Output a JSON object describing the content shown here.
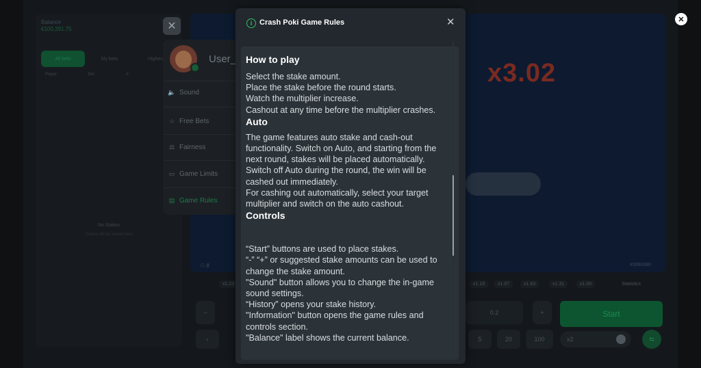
{
  "background": {
    "balance_label": "Balance",
    "balance_value": "€100,391.75",
    "tabs": [
      "All bets",
      "My bets",
      "Highest"
    ],
    "columns": [
      "Player",
      "Bet",
      "X"
    ],
    "no_stakes": "No Stakes",
    "no_stakes_sub": "Stakes will be shown here",
    "multiplier": "x3.02",
    "players_count": "8",
    "round_id": "#3990380",
    "history": [
      "x1.23",
      "x1.18",
      "x1.07",
      "x1.63",
      "x1.31",
      "x1.00"
    ],
    "statistics": "Statistics",
    "stake_value": "0.2",
    "minus": "−",
    "plus": "+",
    "start_label": "Start",
    "quick_amounts": [
      "5",
      "20",
      "100"
    ],
    "auto_value": "x2"
  },
  "menu": {
    "username": "User_",
    "items": [
      {
        "label": "Sound",
        "icon": "speaker-icon"
      },
      {
        "label": "Free Bets",
        "icon": "star-icon"
      },
      {
        "label": "Fairness",
        "icon": "scale-icon"
      },
      {
        "label": "Game Limits",
        "icon": "limits-icon"
      },
      {
        "label": "Game Rules",
        "icon": "rules-icon"
      }
    ],
    "active_item": "Game Rules"
  },
  "modal": {
    "title": "Crash Poki Game Rules",
    "sections": [
      {
        "heading": "How to play",
        "lines": [
          "Select the stake amount.",
          "Place the stake before the round starts.",
          "Watch the multiplier increase.",
          "Cashout at any time before the multiplier crashes."
        ]
      },
      {
        "heading": "Auto",
        "lines": [
          "The game features auto stake and cash-out functionality. Switch on Auto, and starting from the next round, stakes will be placed automatically. Switch off Auto during the round, the win will be cashed out immediately.",
          "For cashing out automatically, select your target multiplier and switch on the auto cashout."
        ]
      },
      {
        "heading": "Controls",
        "lines": [
          "“Start” buttons are used to place stakes.",
          "“-” “+” or suggested stake amounts can be used to change the stake amount.",
          "\"Sound\" button allows you to change the in-game sound settings.",
          "“History” opens your stake history.",
          "\"Information\" button opens the game rules and controls section.",
          "\"Balance\" label shows the current balance."
        ]
      }
    ]
  },
  "colors": {
    "accent": "#2fbf6a",
    "modal_bg": "#22282d",
    "modal_body_bg": "#2c3338"
  }
}
